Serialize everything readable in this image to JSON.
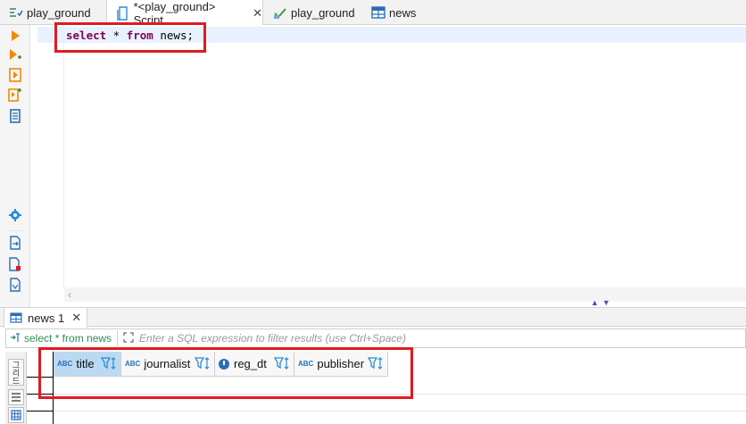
{
  "tabs": [
    {
      "label": "play_ground",
      "icon": "sql-editor-icon",
      "active": false
    },
    {
      "label": "*<play_ground> Script",
      "icon": "script-icon",
      "active": true
    },
    {
      "label": "play_ground",
      "icon": "database-connection-icon",
      "active": false
    },
    {
      "label": "news",
      "icon": "table-icon",
      "active": false
    }
  ],
  "tab_close_glyph": "✕",
  "editor": {
    "kw1": "select",
    "star": " * ",
    "kw2": "from",
    "rest": " news;"
  },
  "results": {
    "tab_label": "news 1",
    "filter_query": "select * from news",
    "filter_placeholder": "Enter a SQL expression to filter results (use Ctrl+Space)",
    "side_label": "그리드",
    "columns": [
      {
        "name": "title",
        "type": "ABC",
        "selected": true
      },
      {
        "name": "journalist",
        "type": "ABC",
        "selected": false
      },
      {
        "name": "reg_dt",
        "type": "datetime",
        "selected": false
      },
      {
        "name": "publisher",
        "type": "ABC",
        "selected": false
      }
    ],
    "type_badge": "ABC"
  },
  "colors": {
    "highlight_box": "#e01a22",
    "keyword": "#7f0055",
    "selected_header": "#bcd9f2"
  }
}
